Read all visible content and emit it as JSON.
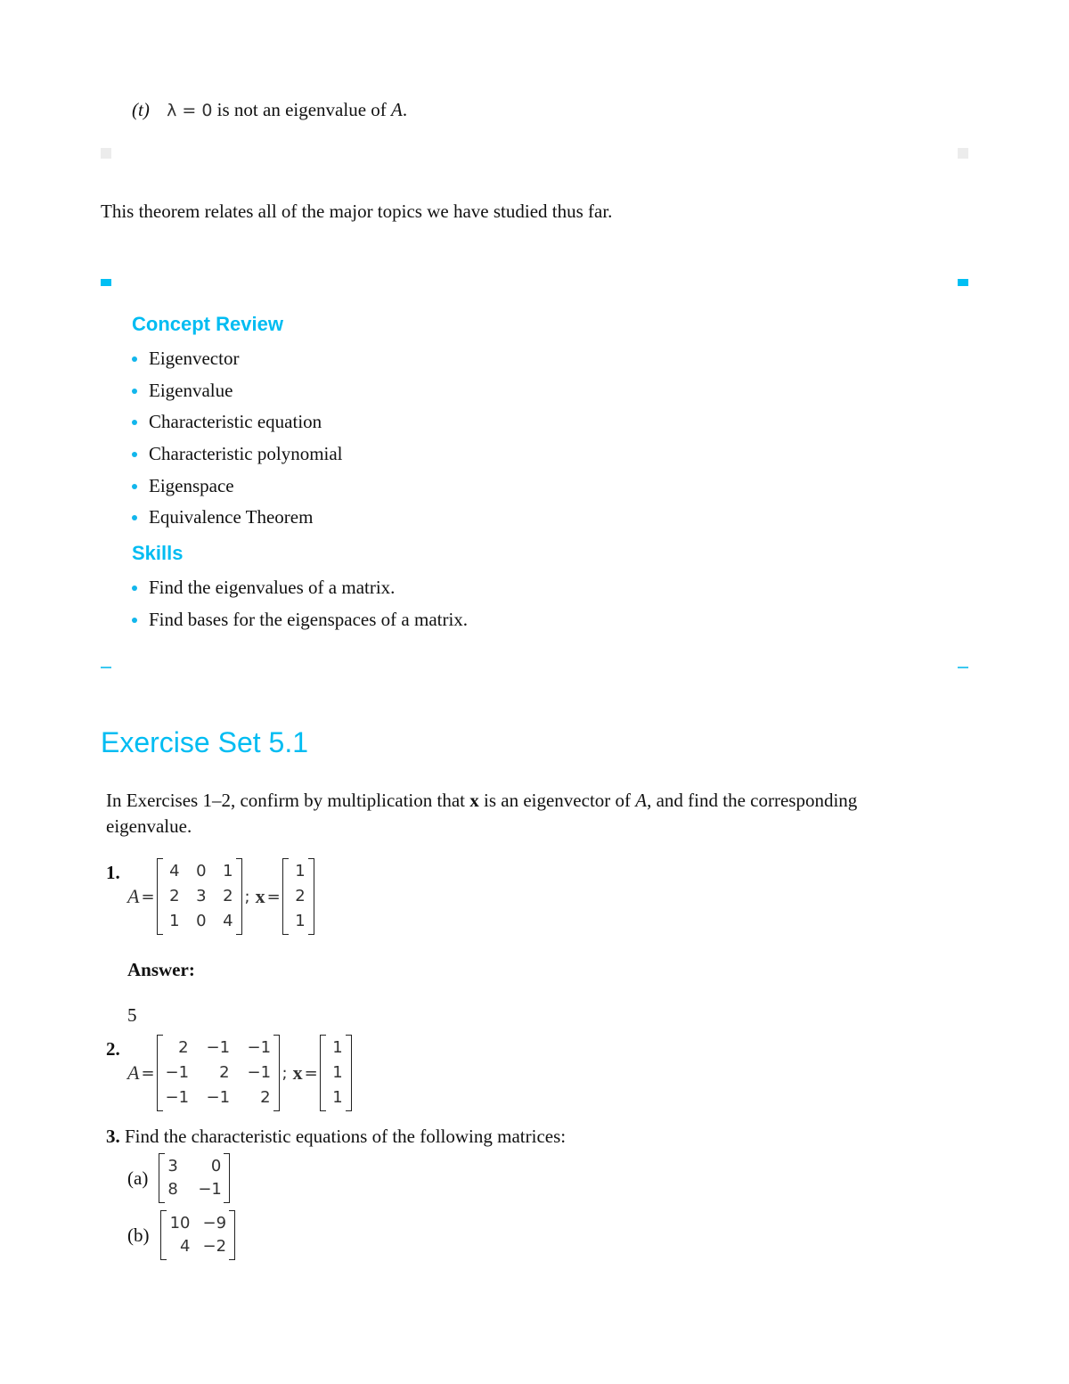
{
  "theorem_item": {
    "label": "(t)",
    "math": "λ = 0",
    "text_before_A": " is not an eigenvalue of ",
    "var": "A",
    "end": "."
  },
  "intro_sentence": "This theorem relates all of the major topics we have studied thus far.",
  "concept_review": {
    "heading": "Concept Review",
    "items": [
      "Eigenvector",
      "Eigenvalue",
      "Characteristic equation",
      "Characteristic polynomial",
      "Eigenspace",
      "Equivalence Theorem"
    ]
  },
  "skills": {
    "heading": "Skills",
    "items": [
      "Find the eigenvalues of a matrix.",
      "Find bases for the eigenspaces of a matrix."
    ]
  },
  "exercise_set": {
    "title": "Exercise Set 5.1",
    "instructions_part1": "In Exercises 1–2, confirm by multiplication that ",
    "instructions_bold": "x",
    "instructions_part2": " is an eigenvector of ",
    "instructions_var": "A",
    "instructions_part3": ", and find the corresponding eigenvalue.",
    "exercises": [
      {
        "number": "1.",
        "A_label": "A",
        "x_label": "x",
        "sep": ";",
        "A": [
          [
            "4",
            "0",
            "1"
          ],
          [
            "2",
            "3",
            "2"
          ],
          [
            "1",
            "0",
            "4"
          ]
        ],
        "x": [
          [
            "1"
          ],
          [
            "2"
          ],
          [
            "1"
          ]
        ],
        "answer_label": "Answer:",
        "answer": "5"
      },
      {
        "number": "2.",
        "A_label": "A",
        "x_label": "x",
        "sep": ";",
        "A": [
          [
            "2",
            "−1",
            "−1"
          ],
          [
            "−1",
            "2",
            "−1"
          ],
          [
            "−1",
            "−1",
            "2"
          ]
        ],
        "x": [
          [
            "1"
          ],
          [
            "1"
          ],
          [
            "1"
          ]
        ]
      },
      {
        "number": "3.",
        "prompt": "Find the characteristic equations of the following matrices:",
        "parts": [
          {
            "label": "(a)",
            "M": [
              [
                "3",
                "0"
              ],
              [
                "8",
                "−1"
              ]
            ]
          },
          {
            "label": "(b)",
            "M": [
              [
                "10",
                "−9"
              ],
              [
                "4",
                "−2"
              ]
            ]
          }
        ]
      }
    ]
  },
  "colors": {
    "accent_blue": "#00bcf2",
    "marker_gray": "#ececec"
  }
}
